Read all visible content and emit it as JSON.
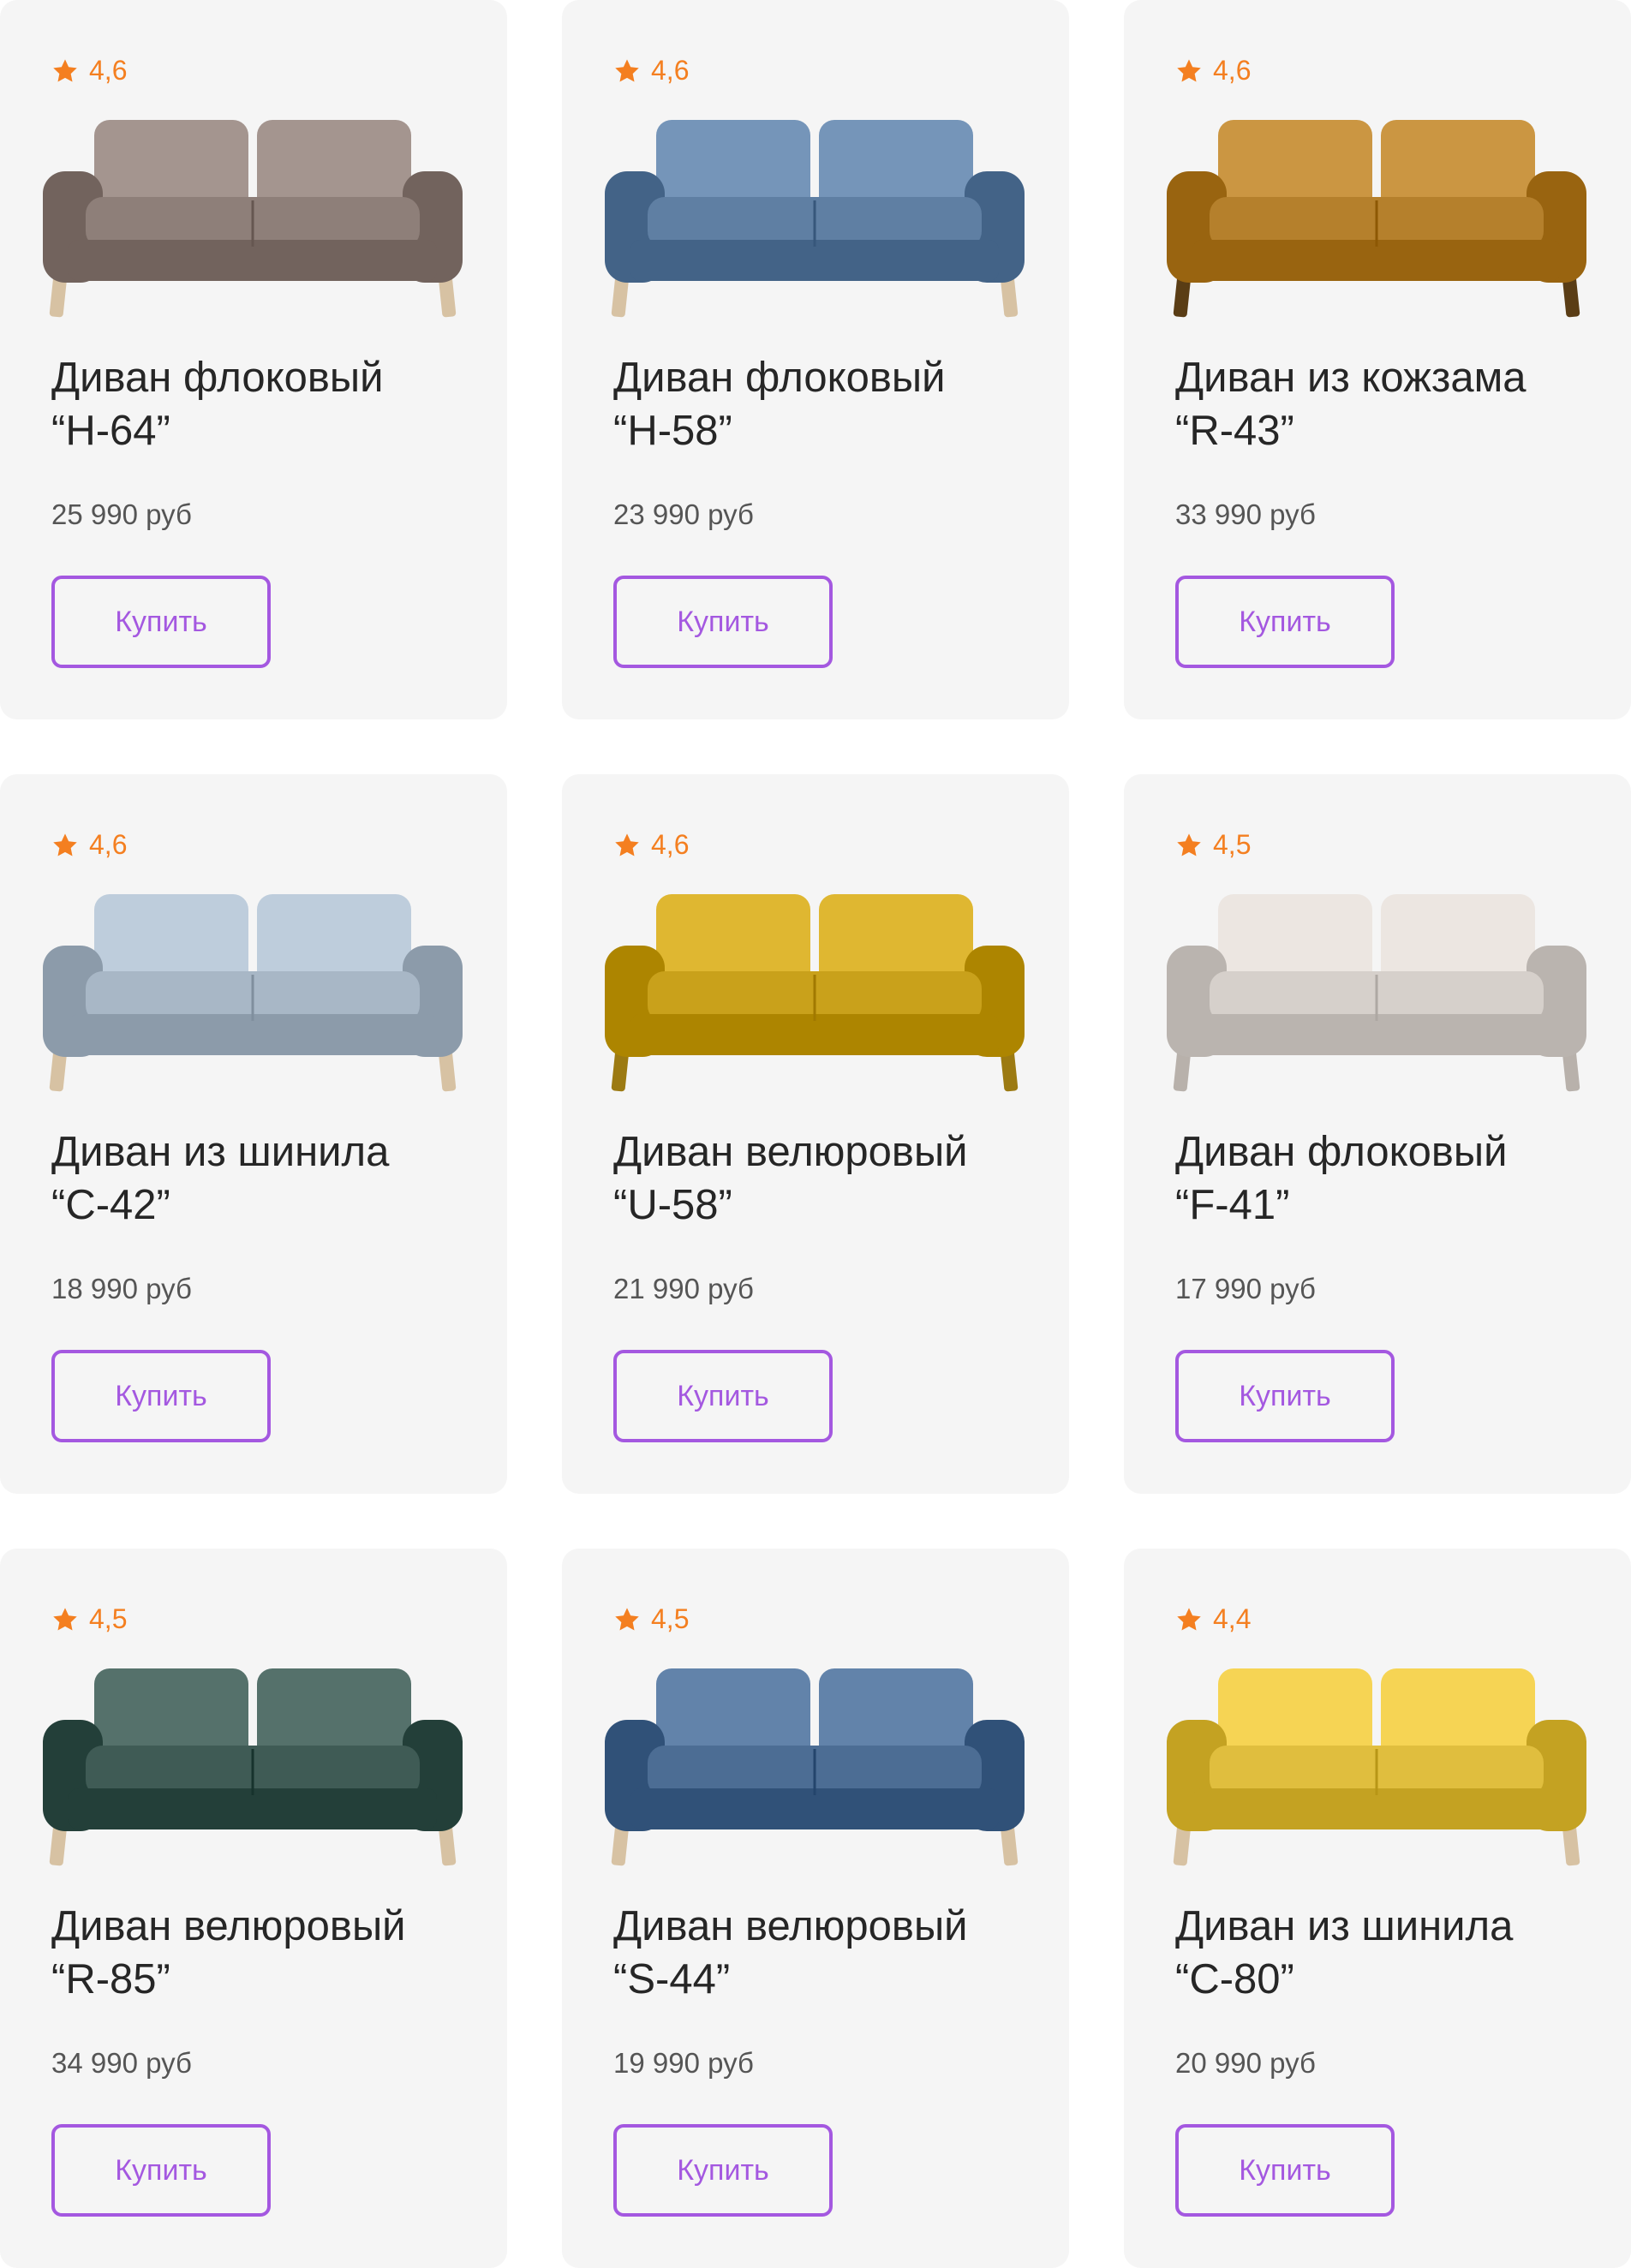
{
  "accent_color": "#a458e0",
  "rating_color": "#f47f20",
  "products": [
    {
      "rating": "4,6",
      "title": "Диван флоковый\n“H-64”",
      "price": "25 990 руб",
      "button": "Купить",
      "sofa_color": "#8e7f79",
      "leg_color": "#d7c2a3"
    },
    {
      "rating": "4,6",
      "title": "Диван флоковый\n“H-58”",
      "price": "23 990 руб",
      "button": "Купить",
      "sofa_color": "#5f7fa3",
      "leg_color": "#d7c2a3"
    },
    {
      "rating": "4,6",
      "title": "Диван из кожзама\n“R-43”",
      "price": "33 990 руб",
      "button": "Купить",
      "sofa_color": "#b5802c",
      "leg_color": "#5a3d15"
    },
    {
      "rating": "4,6",
      "title": "Диван из шинила\n“C-42”",
      "price": "18 990 руб",
      "button": "Купить",
      "sofa_color": "#a8b7c6",
      "leg_color": "#d7c2a3"
    },
    {
      "rating": "4,6",
      "title": "Диван велюровый\n“U-58”",
      "price": "21 990 руб",
      "button": "Купить",
      "sofa_color": "#c9a11b",
      "leg_color": "#9c7a12"
    },
    {
      "rating": "4,5",
      "title": "Диван флоковый\n“F-41”",
      "price": "17 990 руб",
      "button": "Купить",
      "sofa_color": "#d6d0cb",
      "leg_color": "#b8b1ab"
    },
    {
      "rating": "4,5",
      "title": "Диван велюровый\n“R-85”",
      "price": "34 990 руб",
      "button": "Купить",
      "sofa_color": "#3f5b55",
      "leg_color": "#d7c2a3"
    },
    {
      "rating": "4,5",
      "title": "Диван велюровый\n“S-44”",
      "price": "19 990 руб",
      "button": "Купить",
      "sofa_color": "#4c6d94",
      "leg_color": "#d7c2a3"
    },
    {
      "rating": "4,4",
      "title": "Диван из шинила\n“C-80”",
      "price": "20 990 руб",
      "button": "Купить",
      "sofa_color": "#e0be3e",
      "leg_color": "#d7c2a3"
    }
  ]
}
